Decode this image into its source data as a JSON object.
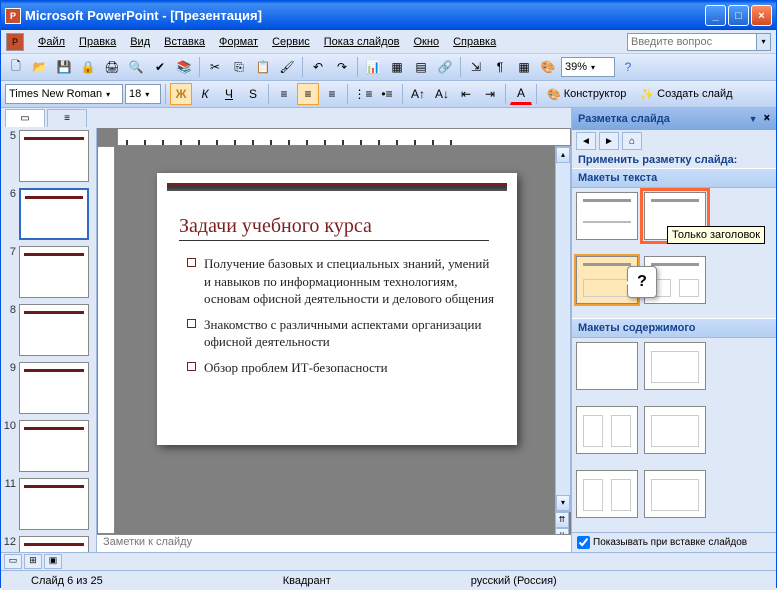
{
  "titlebar": {
    "app": "Microsoft PowerPoint",
    "doc": "[Презентация]"
  },
  "menu": {
    "file": "Файл",
    "edit": "Правка",
    "view": "Вид",
    "insert": "Вставка",
    "format": "Формат",
    "tools": "Сервис",
    "slideshow": "Показ слайдов",
    "window": "Окно",
    "help": "Справка"
  },
  "question_placeholder": "Введите вопрос",
  "toolbar": {
    "zoom": "39%"
  },
  "format": {
    "font": "Times New Roman",
    "size": "18",
    "bold": "Ж",
    "italic": "К",
    "underline": "Ч",
    "shadow": "S",
    "designer": "Конструктор",
    "newslide": "Создать слайд"
  },
  "thumbs": {
    "start": 5,
    "items": [
      5,
      6,
      7,
      8,
      9,
      10,
      11,
      12
    ],
    "selected": 6
  },
  "slide": {
    "title": "Задачи учебного курса",
    "bullets": [
      "Получение базовых и специальных знаний, умений и навыков по информационным технологиям, основам офисной деятельности и делового общения",
      "Знакомство с различными аспектами организации офисной деятельности",
      "Обзор проблем ИТ-безопасности"
    ]
  },
  "notes_placeholder": "Заметки к слайду",
  "taskpane": {
    "title": "Разметка слайда",
    "apply": "Применить разметку слайда:",
    "sec_text": "Макеты текста",
    "sec_content": "Макеты содержимого",
    "tooltip": "Только заголовок",
    "balloon": "?",
    "show_on_insert": "Показывать при вставке слайдов"
  },
  "status": {
    "slide": "Слайд 6 из 25",
    "layout": "Квадрант",
    "lang": "русский (Россия)"
  }
}
